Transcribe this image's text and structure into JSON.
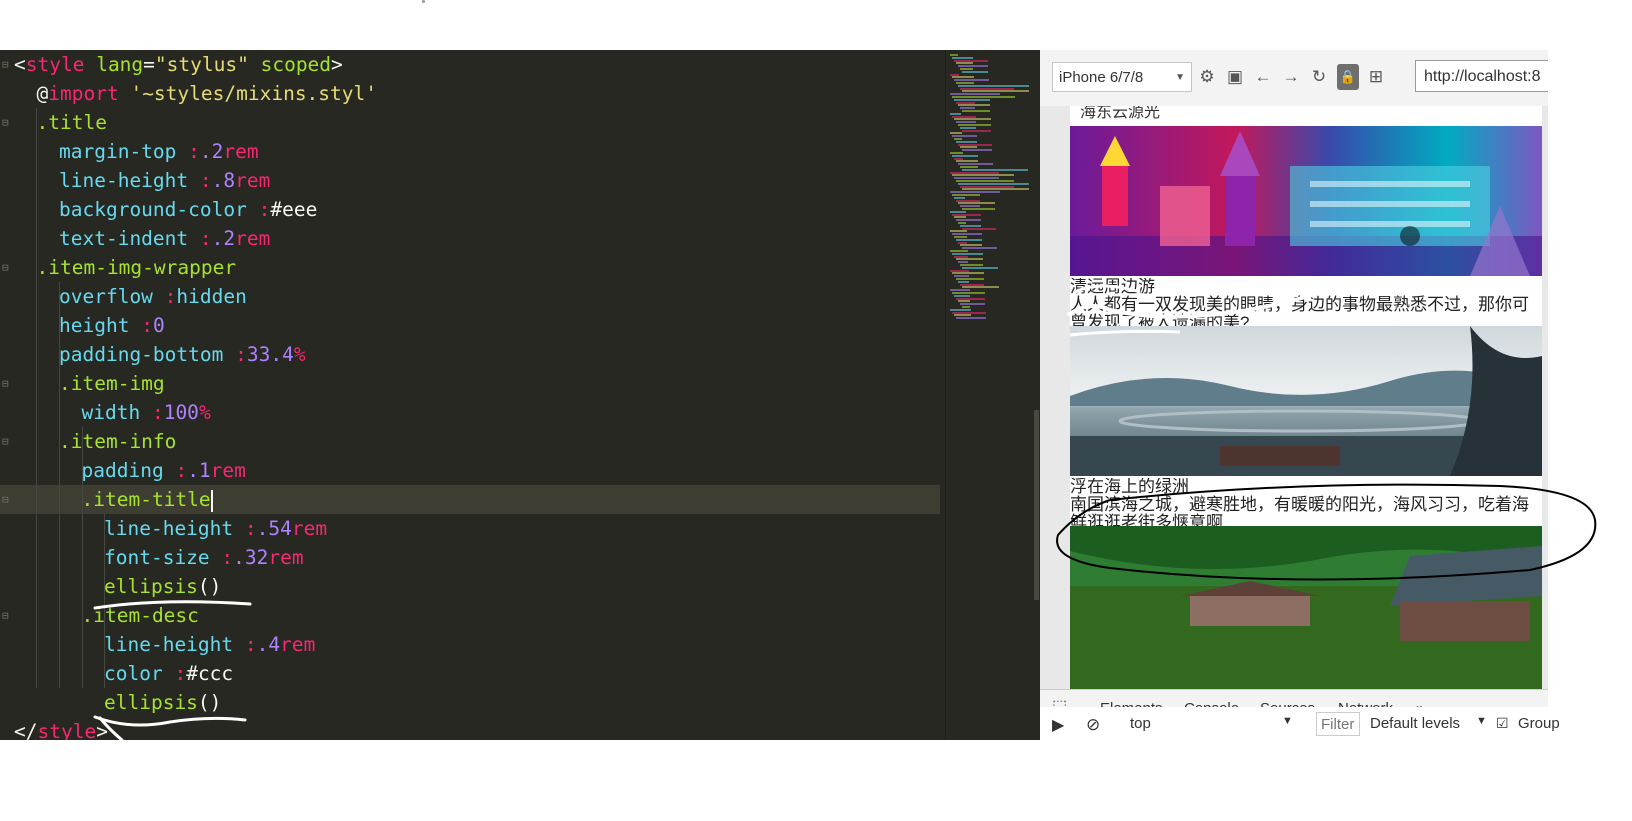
{
  "editor": {
    "lines": [
      {
        "fold": "⊟",
        "indent": 0,
        "tokens": [
          [
            "c-plain",
            "<"
          ],
          [
            "c-tag",
            "style"
          ],
          [
            "c-plain",
            " "
          ],
          [
            "c-attr",
            "lang"
          ],
          [
            "c-plain",
            "="
          ],
          [
            "c-str",
            "\"stylus\""
          ],
          [
            "c-plain",
            " "
          ],
          [
            "c-attr",
            "scoped"
          ],
          [
            "c-plain",
            ">"
          ]
        ]
      },
      {
        "fold": "",
        "indent": 1,
        "tokens": [
          [
            "c-plain",
            "@"
          ],
          [
            "c-tag",
            "import"
          ],
          [
            "c-plain",
            " "
          ],
          [
            "c-str",
            "'~styles/mixins.styl'"
          ]
        ]
      },
      {
        "fold": "⊟",
        "indent": 1,
        "tokens": [
          [
            "c-sel",
            ".title"
          ]
        ]
      },
      {
        "fold": "",
        "indent": 2,
        "tokens": [
          [
            "c-prop",
            "margin-top"
          ],
          [
            "c-plain",
            " "
          ],
          [
            "c-punc",
            ":"
          ],
          [
            "c-num",
            ".2"
          ],
          [
            "c-unit",
            "rem"
          ]
        ]
      },
      {
        "fold": "",
        "indent": 2,
        "tokens": [
          [
            "c-prop",
            "line-height"
          ],
          [
            "c-plain",
            " "
          ],
          [
            "c-punc",
            ":"
          ],
          [
            "c-num",
            ".8"
          ],
          [
            "c-unit",
            "rem"
          ]
        ]
      },
      {
        "fold": "",
        "indent": 2,
        "tokens": [
          [
            "c-prop",
            "background-color"
          ],
          [
            "c-plain",
            " "
          ],
          [
            "c-punc",
            ":"
          ],
          [
            "c-plain",
            "#eee"
          ]
        ]
      },
      {
        "fold": "",
        "indent": 2,
        "tokens": [
          [
            "c-prop",
            "text-indent"
          ],
          [
            "c-plain",
            " "
          ],
          [
            "c-punc",
            ":"
          ],
          [
            "c-num",
            ".2"
          ],
          [
            "c-unit",
            "rem"
          ]
        ]
      },
      {
        "fold": "⊟",
        "indent": 1,
        "tokens": [
          [
            "c-sel",
            ".item-img-wrapper"
          ]
        ]
      },
      {
        "fold": "",
        "indent": 2,
        "tokens": [
          [
            "c-prop",
            "overflow"
          ],
          [
            "c-plain",
            " "
          ],
          [
            "c-punc",
            ":"
          ],
          [
            "c-prop",
            "hidden"
          ]
        ]
      },
      {
        "fold": "",
        "indent": 2,
        "tokens": [
          [
            "c-prop",
            "height"
          ],
          [
            "c-plain",
            " "
          ],
          [
            "c-punc",
            ":"
          ],
          [
            "c-num",
            "0"
          ]
        ]
      },
      {
        "fold": "",
        "indent": 2,
        "tokens": [
          [
            "c-prop",
            "padding-bottom"
          ],
          [
            "c-plain",
            " "
          ],
          [
            "c-punc",
            ":"
          ],
          [
            "c-num",
            "33.4"
          ],
          [
            "c-unit",
            "%"
          ]
        ]
      },
      {
        "fold": "⊟",
        "indent": 2,
        "tokens": [
          [
            "c-sel",
            ".item-img"
          ]
        ]
      },
      {
        "fold": "",
        "indent": 3,
        "tokens": [
          [
            "c-prop",
            "width"
          ],
          [
            "c-plain",
            " "
          ],
          [
            "c-punc",
            ":"
          ],
          [
            "c-num",
            "100"
          ],
          [
            "c-unit",
            "%"
          ]
        ]
      },
      {
        "fold": "⊟",
        "indent": 2,
        "tokens": [
          [
            "c-sel",
            ".item-info"
          ]
        ]
      },
      {
        "fold": "",
        "indent": 3,
        "tokens": [
          [
            "c-prop",
            "padding"
          ],
          [
            "c-plain",
            " "
          ],
          [
            "c-punc",
            ":"
          ],
          [
            "c-num",
            ".1"
          ],
          [
            "c-unit",
            "rem"
          ]
        ]
      },
      {
        "fold": "⊟",
        "indent": 3,
        "active": true,
        "tokens": [
          [
            "c-sel",
            ".item-title"
          ]
        ]
      },
      {
        "fold": "",
        "indent": 4,
        "tokens": [
          [
            "c-prop",
            "line-height"
          ],
          [
            "c-plain",
            " "
          ],
          [
            "c-punc",
            ":"
          ],
          [
            "c-num",
            ".54"
          ],
          [
            "c-unit",
            "rem"
          ]
        ]
      },
      {
        "fold": "",
        "indent": 4,
        "tokens": [
          [
            "c-prop",
            "font-size"
          ],
          [
            "c-plain",
            " "
          ],
          [
            "c-punc",
            ":"
          ],
          [
            "c-num",
            ".32"
          ],
          [
            "c-unit",
            "rem"
          ]
        ]
      },
      {
        "fold": "",
        "indent": 4,
        "tokens": [
          [
            "c-fn",
            "ellipsis"
          ],
          [
            "c-plain",
            "()"
          ]
        ]
      },
      {
        "fold": "⊟",
        "indent": 3,
        "tokens": [
          [
            "c-sel",
            ".item-desc"
          ]
        ]
      },
      {
        "fold": "",
        "indent": 4,
        "tokens": [
          [
            "c-prop",
            "line-height"
          ],
          [
            "c-plain",
            " "
          ],
          [
            "c-punc",
            ":"
          ],
          [
            "c-num",
            ".4"
          ],
          [
            "c-unit",
            "rem"
          ]
        ]
      },
      {
        "fold": "",
        "indent": 4,
        "tokens": [
          [
            "c-prop",
            "color"
          ],
          [
            "c-plain",
            " "
          ],
          [
            "c-punc",
            ":"
          ],
          [
            "c-plain",
            "#ccc"
          ]
        ]
      },
      {
        "fold": "",
        "indent": 4,
        "tokens": [
          [
            "c-fn",
            "ellipsis"
          ],
          [
            "c-plain",
            "()"
          ]
        ]
      },
      {
        "fold": "",
        "indent": 0,
        "tokens": [
          [
            "c-plain",
            "</"
          ],
          [
            "c-tag",
            "style"
          ],
          [
            "c-plain",
            ">"
          ]
        ]
      }
    ]
  },
  "browser": {
    "device": "iPhone 6/7/8",
    "url": "http://localhost:8",
    "toolbar_icons": [
      "settings-icon",
      "screenshot-icon",
      "back-icon",
      "forward-icon",
      "reload-icon",
      "lock-icon",
      "grid-icon"
    ],
    "toolbar_glyphs": [
      "⚙",
      "▣",
      "←",
      "→",
      "↻",
      "🔒",
      "⊞"
    ],
    "cut_title": "海东云源光",
    "items": [
      {
        "title": "清远周边游",
        "desc": "人人都有一双发现美的眼睛，身边的事物最熟悉不过，那你可曾发现了被人遗漏的美?"
      },
      {
        "title": "浮在海上的绿洲",
        "desc": "南国滨海之城，避寒胜地，有暖暖的阳光，海风习习，吃着海鲜逛逛老街多惬意啊"
      }
    ]
  },
  "devtools": {
    "tabs": [
      "Elements",
      "Console",
      "Sources",
      "Network"
    ],
    "more": "»",
    "active_tab": "Console",
    "context": "top",
    "filter_placeholder": "Filter",
    "levels": "Default levels",
    "group_label": "Group"
  }
}
